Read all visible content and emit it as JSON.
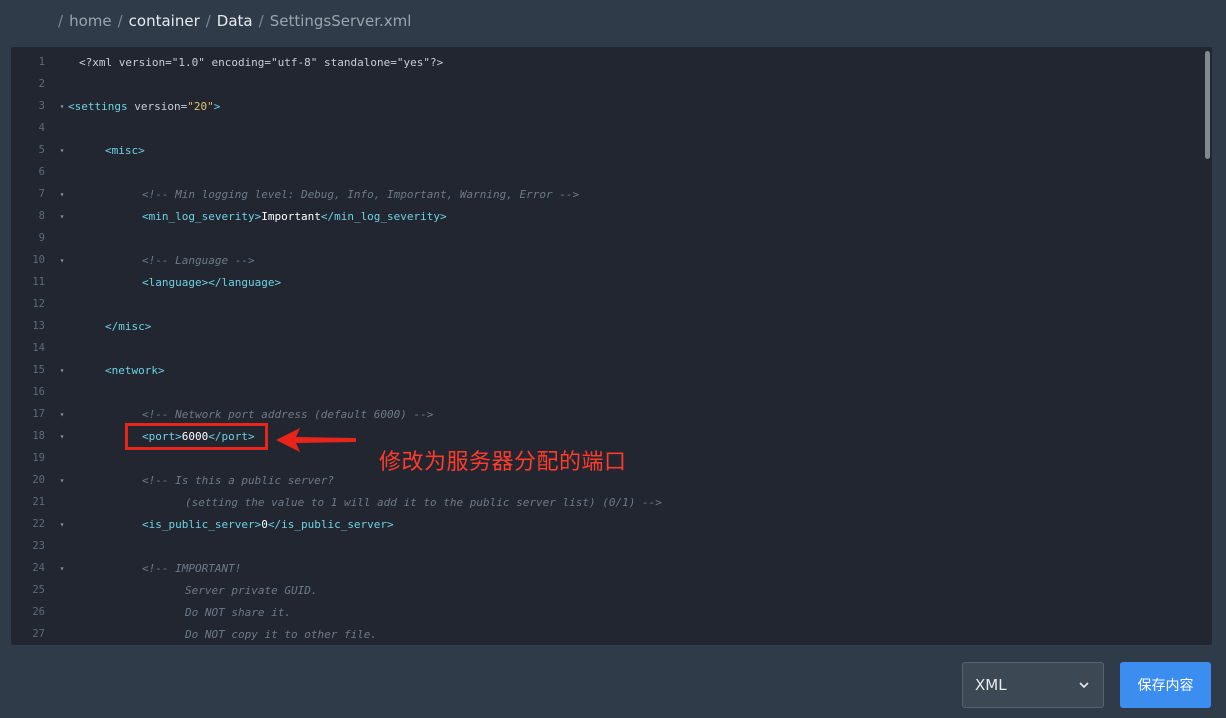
{
  "breadcrumb": {
    "items": [
      "home",
      "container",
      "Data",
      "SettingsServer.xml"
    ],
    "separator": "/"
  },
  "editor": {
    "lines": [
      {
        "n": "1",
        "fold": false
      },
      {
        "n": "2",
        "fold": false
      },
      {
        "n": "3",
        "fold": true
      },
      {
        "n": "4",
        "fold": false
      },
      {
        "n": "5",
        "fold": true
      },
      {
        "n": "6",
        "fold": false
      },
      {
        "n": "7",
        "fold": true
      },
      {
        "n": "8",
        "fold": true
      },
      {
        "n": "9",
        "fold": false
      },
      {
        "n": "10",
        "fold": true
      },
      {
        "n": "11",
        "fold": false
      },
      {
        "n": "12",
        "fold": false
      },
      {
        "n": "13",
        "fold": false
      },
      {
        "n": "14",
        "fold": false
      },
      {
        "n": "15",
        "fold": true
      },
      {
        "n": "16",
        "fold": false
      },
      {
        "n": "17",
        "fold": true
      },
      {
        "n": "18",
        "fold": true
      },
      {
        "n": "19",
        "fold": false
      },
      {
        "n": "20",
        "fold": true
      },
      {
        "n": "21",
        "fold": false
      },
      {
        "n": "22",
        "fold": true
      },
      {
        "n": "23",
        "fold": false
      },
      {
        "n": "24",
        "fold": true
      },
      {
        "n": "25",
        "fold": false
      },
      {
        "n": "26",
        "fold": false
      },
      {
        "n": "27",
        "fold": false
      }
    ],
    "code": {
      "l1": {
        "decl": "<?xml version=\"1.0\" encoding=\"utf-8\" standalone=\"yes\"?>"
      },
      "l3": {
        "open": "<settings",
        "attr": " version=",
        "val": "\"20\"",
        "close": ">"
      },
      "l5": {
        "tag": "<misc>"
      },
      "l7": {
        "comment": "<!-- Min logging level: Debug, Info, Important, Warning, Error -->"
      },
      "l8": {
        "open": "<min_log_severity>",
        "text": "Important",
        "close": "</min_log_severity>"
      },
      "l10": {
        "comment": "<!-- Language -->"
      },
      "l11": {
        "tag": "<language></language>"
      },
      "l13": {
        "tag": "</misc>"
      },
      "l15": {
        "tag": "<network>"
      },
      "l17": {
        "comment": "<!-- Network port address (default 6000) -->"
      },
      "l18": {
        "open": "<port>",
        "text": "6000",
        "close": "</port>"
      },
      "l20": {
        "comment": "<!-- Is this a public server?"
      },
      "l21": {
        "comment": "(setting the value to 1 will add it to the public server list) (0/1) -->"
      },
      "l22": {
        "open": "<is_public_server>",
        "text": "0",
        "close": "</is_public_server>"
      },
      "l24": {
        "comment": "<!-- IMPORTANT!"
      },
      "l25": {
        "comment": "Server private GUID."
      },
      "l26": {
        "comment": "Do NOT share it."
      },
      "l27": {
        "comment": "Do NOT copy it to other file."
      }
    },
    "fold_glyph": "▾"
  },
  "annotation": {
    "text": "修改为服务器分配的端口",
    "color": "#ff3b2a"
  },
  "footer": {
    "format_select": {
      "value": "XML"
    },
    "save_label": "保存内容"
  },
  "colors": {
    "background": "#2f3b48",
    "editor_bg": "#212631",
    "accent": "#3b8ef0",
    "tag": "#6fd2e1",
    "string": "#e3c56a",
    "comment": "#6f7a88"
  }
}
